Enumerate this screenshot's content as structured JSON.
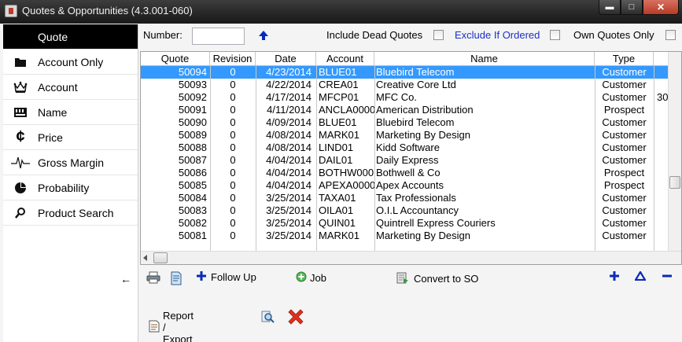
{
  "window": {
    "title": "Quotes & Opportunities (4.3.001-060)"
  },
  "sidebar": {
    "items": [
      {
        "label": "Quote",
        "icon": "quote-icon",
        "active": true
      },
      {
        "label": "Account Only",
        "icon": "folder-icon"
      },
      {
        "label": "Account",
        "icon": "crown-icon"
      },
      {
        "label": "Name",
        "icon": "keyboard-icon"
      },
      {
        "label": "Price",
        "icon": "cent-icon"
      },
      {
        "label": "Gross Margin",
        "icon": "pulse-icon"
      },
      {
        "label": "Probability",
        "icon": "pie-icon"
      },
      {
        "label": "Product Search",
        "icon": "search-icon"
      }
    ],
    "collapse_glyph": "←"
  },
  "filters": {
    "number_label": "Number:",
    "number_value": "",
    "include_dead_label": "Include Dead Quotes",
    "exclude_ordered_label": "Exclude If Ordered",
    "own_quotes_label": "Own Quotes Only",
    "link_color": "#1a2fc7"
  },
  "grid": {
    "columns": [
      "Quote",
      "Revision",
      "Date",
      "Account",
      "Name",
      "Type"
    ],
    "rows": [
      {
        "quote": "50094",
        "revision": "0",
        "date": "4/23/2014",
        "account": "BLUE01",
        "name": "Bluebird Telecom",
        "type": "Customer",
        "extra": "",
        "selected": true
      },
      {
        "quote": "50093",
        "revision": "0",
        "date": "4/22/2014",
        "account": "CREA01",
        "name": "Creative Core Ltd",
        "type": "Customer",
        "extra": ""
      },
      {
        "quote": "50092",
        "revision": "0",
        "date": "4/17/2014",
        "account": "MFCP01",
        "name": "MFC Co.",
        "type": "Customer",
        "extra": "30"
      },
      {
        "quote": "50091",
        "revision": "0",
        "date": "4/11/2014",
        "account": "ANCLA0000",
        "name": "American Distribution",
        "type": "Prospect",
        "extra": ""
      },
      {
        "quote": "50090",
        "revision": "0",
        "date": "4/09/2014",
        "account": "BLUE01",
        "name": "Bluebird Telecom",
        "type": "Customer",
        "extra": ""
      },
      {
        "quote": "50089",
        "revision": "0",
        "date": "4/08/2014",
        "account": "MARK01",
        "name": "Marketing By Design",
        "type": "Customer",
        "extra": ""
      },
      {
        "quote": "50088",
        "revision": "0",
        "date": "4/08/2014",
        "account": "LIND01",
        "name": "Kidd Software",
        "type": "Customer",
        "extra": ""
      },
      {
        "quote": "50087",
        "revision": "0",
        "date": "4/04/2014",
        "account": "DAIL01",
        "name": "Daily Express",
        "type": "Customer",
        "extra": ""
      },
      {
        "quote": "50086",
        "revision": "0",
        "date": "4/04/2014",
        "account": "BOTHW000",
        "name": "Bothwell & Co",
        "type": "Prospect",
        "extra": ""
      },
      {
        "quote": "50085",
        "revision": "0",
        "date": "4/04/2014",
        "account": "APEXA0000",
        "name": "Apex Accounts",
        "type": "Prospect",
        "extra": ""
      },
      {
        "quote": "50084",
        "revision": "0",
        "date": "3/25/2014",
        "account": "TAXA01",
        "name": "Tax Professionals",
        "type": "Customer",
        "extra": ""
      },
      {
        "quote": "50083",
        "revision": "0",
        "date": "3/25/2014",
        "account": "OILA01",
        "name": "O.I.L Accountancy",
        "type": "Customer",
        "extra": ""
      },
      {
        "quote": "50082",
        "revision": "0",
        "date": "3/25/2014",
        "account": "QUIN01",
        "name": "Quintrell Express Couriers",
        "type": "Customer",
        "extra": ""
      },
      {
        "quote": "50081",
        "revision": "0",
        "date": "3/25/2014",
        "account": "MARK01",
        "name": "Marketing By Design",
        "type": "Customer",
        "extra": ""
      }
    ]
  },
  "toolbar": {
    "follow_up_label": "Follow Up",
    "job_label": "Job",
    "convert_label": "Convert to SO"
  },
  "bottom": {
    "report_label": "Report / Export"
  },
  "colors": {
    "selection": "#3399ff",
    "accent_blue": "#0a2ab8",
    "close_red": "#e0301e"
  }
}
